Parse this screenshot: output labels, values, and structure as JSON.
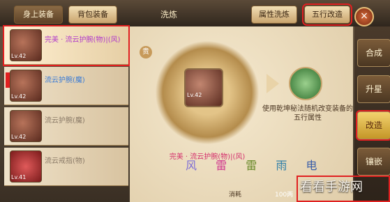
{
  "tabs": {
    "equip_on": "身上装备",
    "bag_equip": "背包装备",
    "title": "洗炼",
    "attr_refine": "属性洗炼",
    "five_elem": "五行改造"
  },
  "close_icon": "×",
  "items": [
    {
      "name": "完美 · 流云护腕(物)|(风)",
      "lv": "Lv.42",
      "color": "purple"
    },
    {
      "name": "流云护腕(魔)",
      "lv": "Lv.42",
      "color": "blue"
    },
    {
      "name": "流云护腕(魔)",
      "lv": "Lv.42",
      "color": "gray"
    },
    {
      "name": "流云戒指(物)",
      "lv": "Lv.41",
      "color": "gray"
    }
  ],
  "main": {
    "badge": "贵",
    "item_lv": "Lv.42",
    "item_name": "完美 · 流云护腕(物)|(风)",
    "hint": "使用乾坤秘法随机改变装备的五行属性",
    "elements": [
      "风",
      "雷",
      "雷",
      "雨",
      "电"
    ],
    "cost_label": "消耗",
    "cost_value": "100两"
  },
  "sidebar": {
    "items": [
      "合成",
      "升星",
      "改造",
      "镶嵌"
    ]
  },
  "watermark": "看看手游网"
}
